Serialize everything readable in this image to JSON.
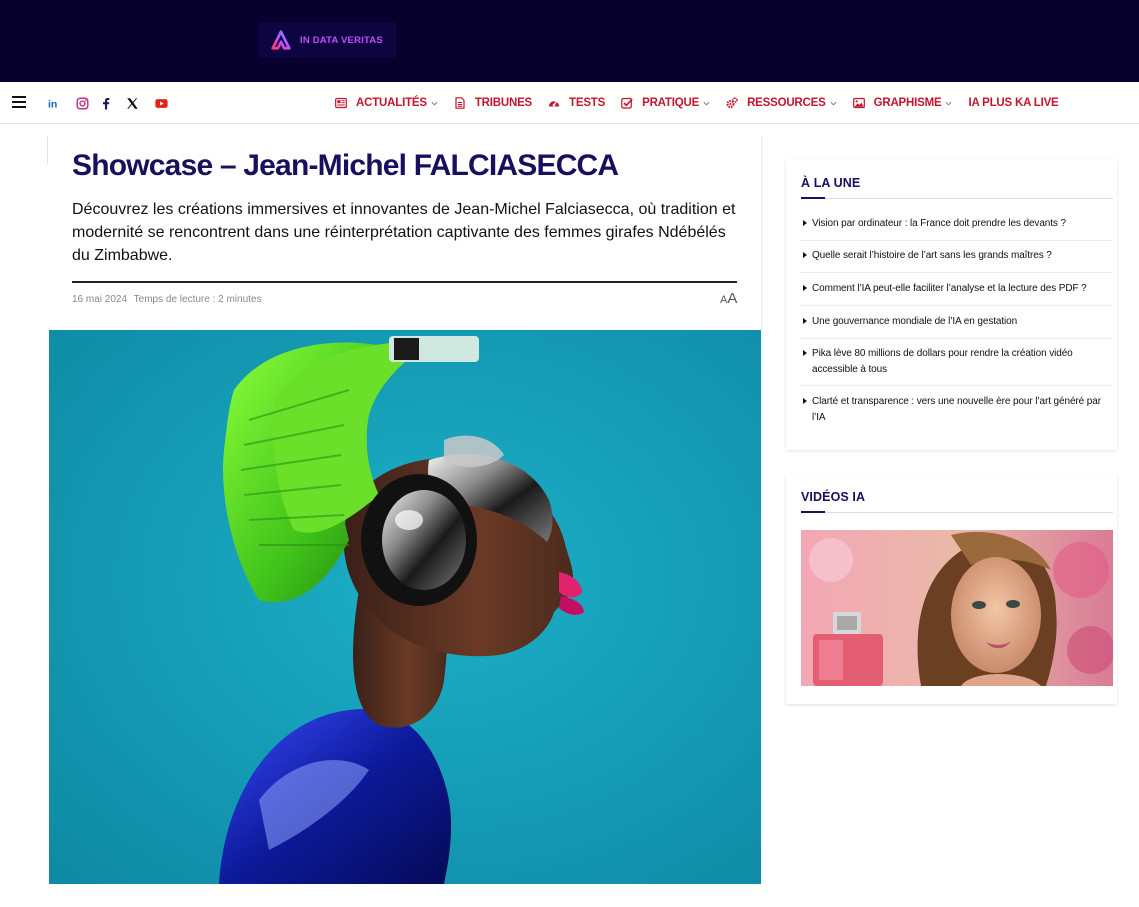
{
  "header": {
    "logo_text": "IN DATA VERITAS"
  },
  "nav": {
    "social": [
      {
        "icon": "linkedin-icon",
        "color": "#0a66c2"
      },
      {
        "icon": "instagram-icon",
        "color": "#c13584"
      },
      {
        "icon": "facebook-icon",
        "color": "#1a1a5e"
      },
      {
        "icon": "x-icon",
        "color": "#111111"
      },
      {
        "icon": "youtube-icon",
        "color": "#e62117"
      }
    ],
    "menu": [
      {
        "label": "ACTUALITÉS",
        "icon": "newspaper-icon",
        "dropdown": true
      },
      {
        "label": "TRIBUNES",
        "icon": "document-icon",
        "dropdown": false
      },
      {
        "label": "TESTS",
        "icon": "gauge-icon",
        "dropdown": false
      },
      {
        "label": "PRATIQUE",
        "icon": "check-square-icon",
        "dropdown": true
      },
      {
        "label": "RESSOURCES",
        "icon": "gears-icon",
        "dropdown": true
      },
      {
        "label": "GRAPHISME",
        "icon": "image-icon",
        "dropdown": true
      },
      {
        "label": "IA PLUS KA LIVE",
        "icon": "",
        "dropdown": false
      }
    ],
    "accent_color": "#c3162c"
  },
  "article": {
    "title": "Showcase – Jean-Michel FALCIASECCA",
    "subtitle": "Découvrez les créations immersives et innovantes de Jean-Michel Falciasecca, où tradition et modernité se rencontrent dans une réinterprétation captivante des femmes girafes Ndébélés du Zimbabwe.",
    "date": "16 mai 2024",
    "reading_time": "Temps de lecture : 2 minutes",
    "font_control_small": "A",
    "font_control_large": "A",
    "title_color": "#16105e"
  },
  "sidebar": {
    "a_la_une": {
      "title": "À LA UNE",
      "items": [
        "Vision par ordinateur : la France doit prendre les devants ?",
        "Quelle serait l’histoire de l’art sans les grands maîtres ?",
        "Comment l’IA peut-elle faciliter l’analyse et la lecture des PDF ?",
        "Une gouvernance mondiale de l’IA en gestation",
        "Pika lève 80 millions de dollars pour rendre la création vidéo accessible à tous",
        "Clarté et transparence : vers une nouvelle ère pour l’art généré par l’IA"
      ]
    },
    "videos": {
      "title": "VIDÉOS IA"
    }
  }
}
